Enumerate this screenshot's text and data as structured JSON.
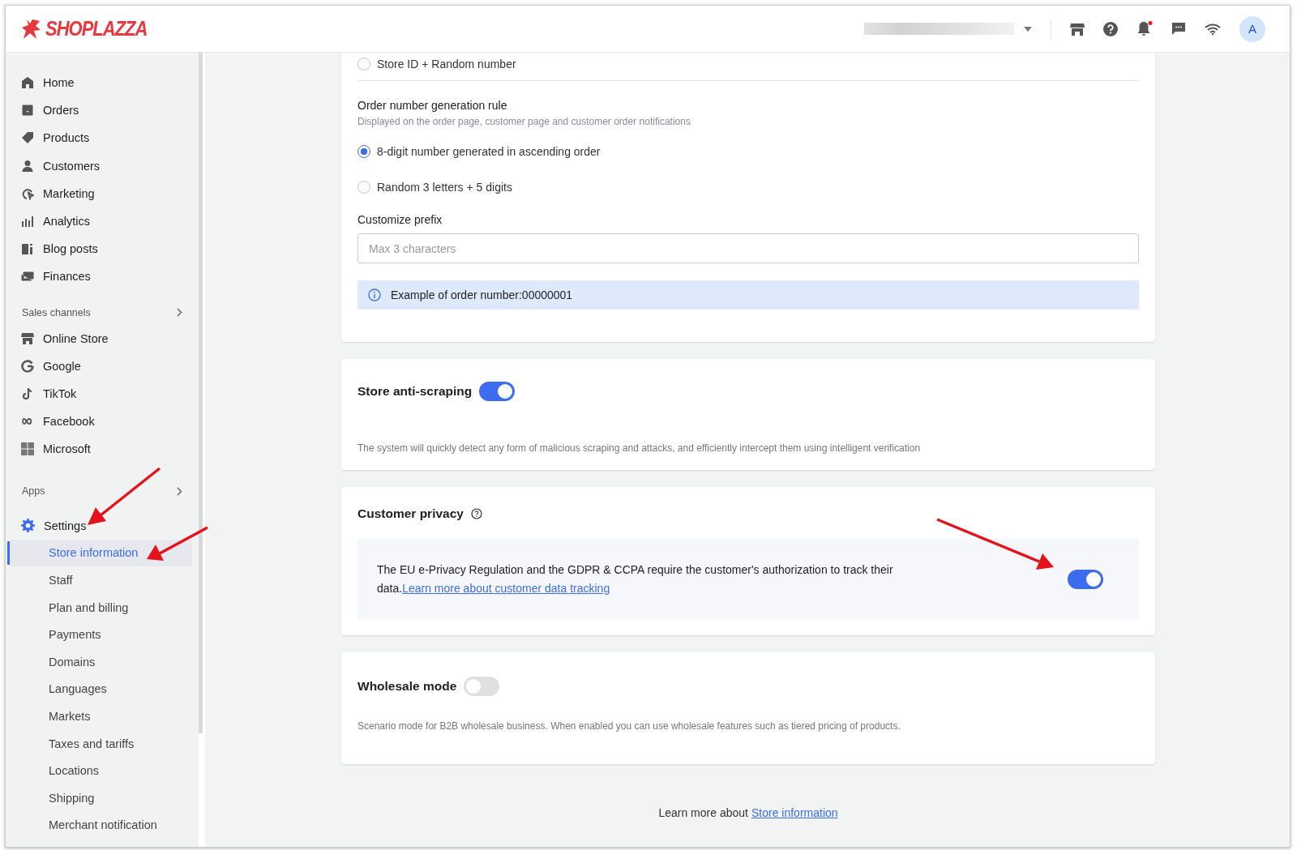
{
  "header": {
    "logo": "SHOPLAZZA",
    "avatar": "A"
  },
  "sidebar": {
    "main": [
      {
        "label": "Home"
      },
      {
        "label": "Orders"
      },
      {
        "label": "Products"
      },
      {
        "label": "Customers"
      },
      {
        "label": "Marketing"
      },
      {
        "label": "Analytics"
      },
      {
        "label": "Blog posts"
      },
      {
        "label": "Finances"
      }
    ],
    "channels_title": "Sales channels",
    "channels": [
      {
        "label": "Online Store"
      },
      {
        "label": "Google"
      },
      {
        "label": "TikTok"
      },
      {
        "label": "Facebook"
      },
      {
        "label": "Microsoft"
      }
    ],
    "apps_title": "Apps",
    "settings": {
      "label": "Settings",
      "children": [
        {
          "label": "Store information",
          "selected": true
        },
        {
          "label": "Staff",
          "selected": false
        },
        {
          "label": "Plan and billing",
          "selected": false
        },
        {
          "label": "Payments",
          "selected": false
        },
        {
          "label": "Domains",
          "selected": false
        },
        {
          "label": "Languages",
          "selected": false
        },
        {
          "label": "Markets",
          "selected": false
        },
        {
          "label": "Taxes and tariffs",
          "selected": false
        },
        {
          "label": "Locations",
          "selected": false
        },
        {
          "label": "Shipping",
          "selected": false
        },
        {
          "label": "Merchant notification",
          "selected": false
        }
      ]
    }
  },
  "order_card": {
    "top_option": {
      "label": "Store ID + Random number",
      "selected": false
    },
    "rule_title": "Order number generation rule",
    "rule_hint": "Displayed on the order page, customer page and customer order notifications",
    "options": [
      {
        "label": "8-digit number generated in ascending order",
        "selected": true
      },
      {
        "label": "Random 3 letters + 5 digits",
        "selected": false
      }
    ],
    "prefix_label": "Customize prefix",
    "prefix_placeholder": "Max 3 characters",
    "example": "Example of order number:00000001"
  },
  "anti_scraping": {
    "title": "Store anti-scraping",
    "on": true,
    "description": "The system will quickly detect any form of malicious scraping and attacks, and efficiently intercept them using intelligent verification"
  },
  "privacy": {
    "title": "Customer privacy",
    "text": "The EU e-Privacy Regulation and the GDPR & CCPA require the customer's authorization to track their data.",
    "link": "Learn more about customer data tracking",
    "on": true
  },
  "wholesale": {
    "title": "Wholesale mode",
    "on": false,
    "description": "Scenario mode for B2B wholesale business. When enabled you can use wholesale features such as tiered pricing of products."
  },
  "footer": {
    "text": "Learn more about",
    "link": "Store information"
  }
}
